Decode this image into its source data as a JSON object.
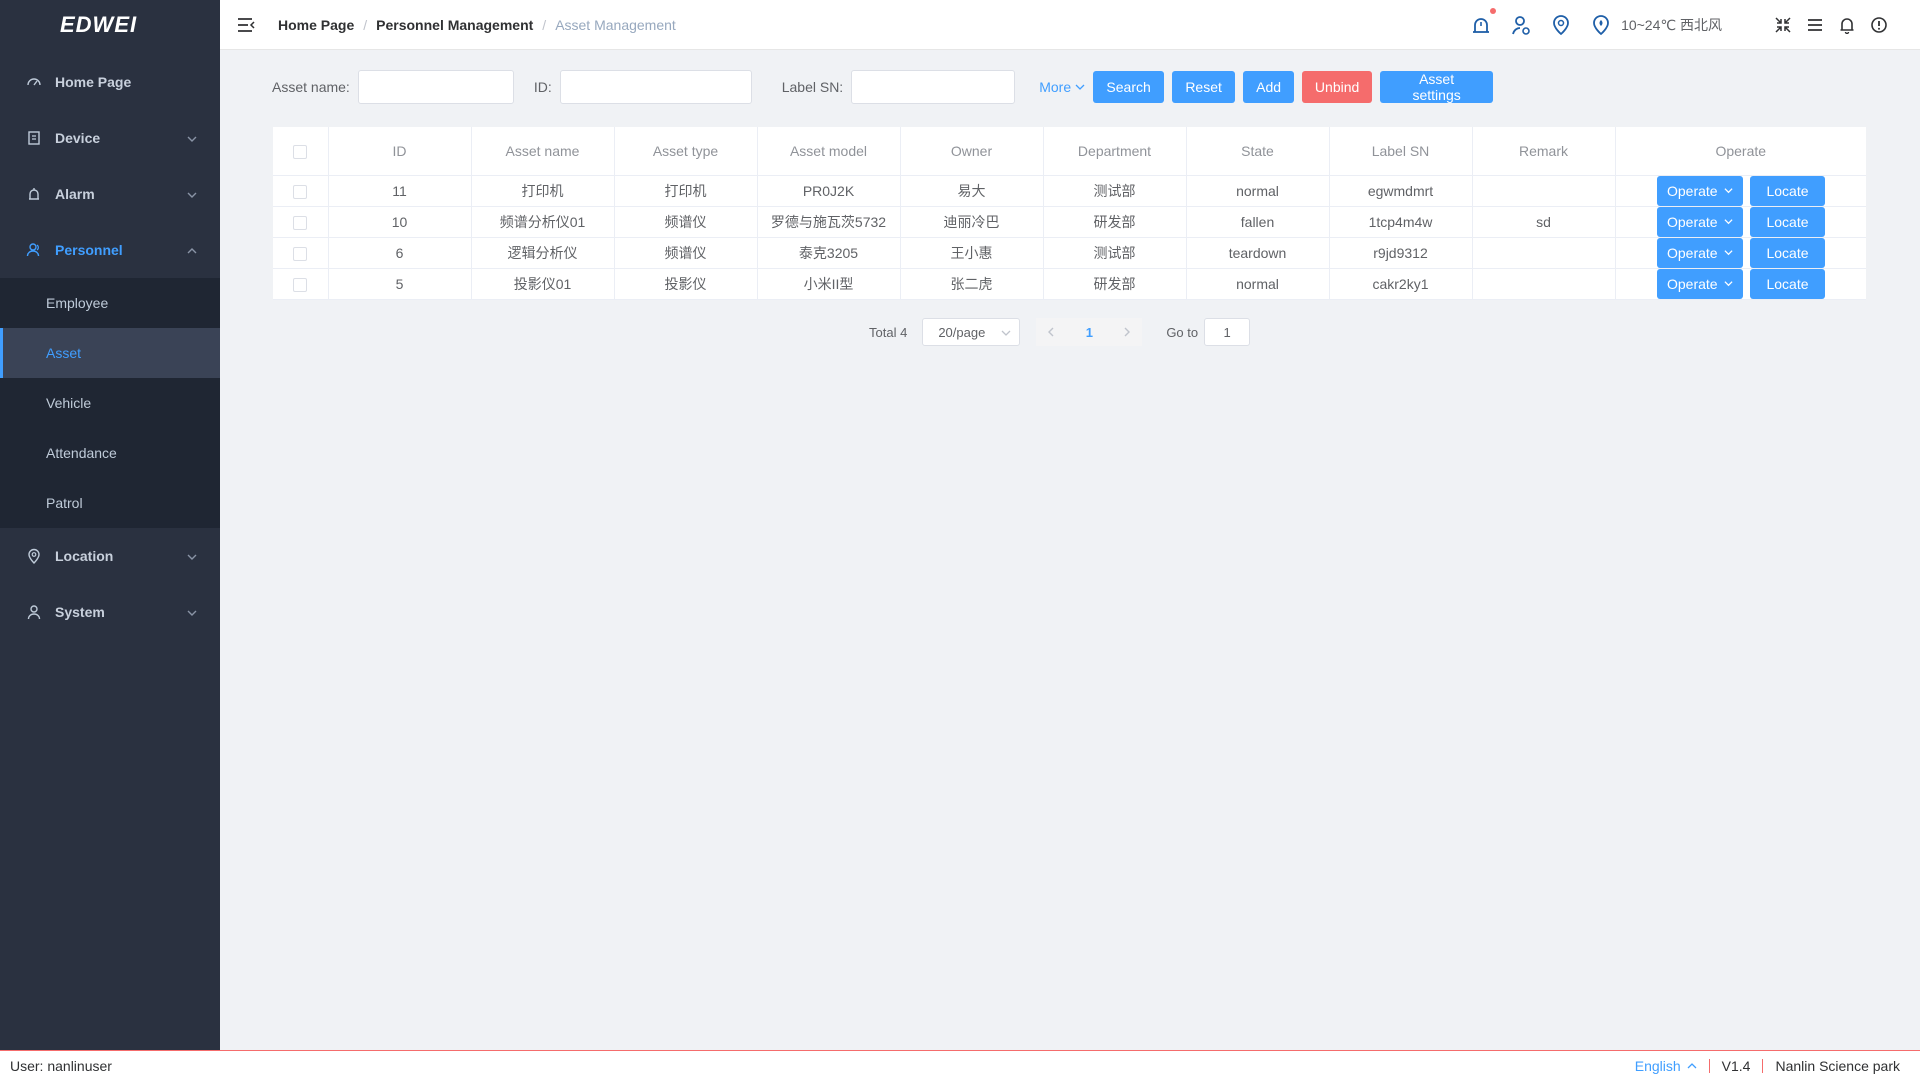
{
  "logo": {
    "text": "EDWEI"
  },
  "sidebar": {
    "items": [
      {
        "label": "Home Page",
        "icon": "dashboard-icon"
      },
      {
        "label": "Device",
        "icon": "device-icon"
      },
      {
        "label": "Alarm",
        "icon": "alarm-icon"
      },
      {
        "label": "Personnel",
        "icon": "personnel-icon"
      },
      {
        "label": "Location",
        "icon": "location-icon"
      },
      {
        "label": "System",
        "icon": "user-icon"
      }
    ],
    "personnel_sub": [
      {
        "label": "Employee"
      },
      {
        "label": "Asset"
      },
      {
        "label": "Vehicle"
      },
      {
        "label": "Attendance"
      },
      {
        "label": "Patrol"
      }
    ]
  },
  "breadcrumb": [
    "Home Page",
    "Personnel Management",
    "Asset Management"
  ],
  "header": {
    "weather": "10~24℃ 西北风"
  },
  "filters": {
    "asset_name_label": "Asset name:",
    "id_label": "ID:",
    "label_sn_label": "Label SN:",
    "asset_name_value": "",
    "id_value": "",
    "label_sn_value": "",
    "more": "More",
    "search": "Search",
    "reset": "Reset",
    "add": "Add",
    "unbind": "Unbind",
    "asset_settings": "Asset settings"
  },
  "table": {
    "columns": [
      "ID",
      "Asset name",
      "Asset type",
      "Asset model",
      "Owner",
      "Department",
      "State",
      "Label SN",
      "Remark",
      "Operate"
    ],
    "rows": [
      {
        "id": "11",
        "name": "打印机",
        "type": "打印机",
        "model": "PR0J2K",
        "owner": "易大",
        "dept": "测试部",
        "state": "normal",
        "sn": "egwmdmrt",
        "remark": ""
      },
      {
        "id": "10",
        "name": "频谱分析仪01",
        "type": "频谱仪",
        "model": "罗德与施瓦茨5732",
        "owner": "迪丽冷巴",
        "dept": "研发部",
        "state": "fallen",
        "sn": "1tcp4m4w",
        "remark": "sd"
      },
      {
        "id": "6",
        "name": "逻辑分析仪",
        "type": "频谱仪",
        "model": "泰克3205",
        "owner": "王小惠",
        "dept": "测试部",
        "state": "teardown",
        "sn": "r9jd9312",
        "remark": ""
      },
      {
        "id": "5",
        "name": "投影仪01",
        "type": "投影仪",
        "model": "小米II型",
        "owner": "张二虎",
        "dept": "研发部",
        "state": "normal",
        "sn": "cakr2ky1",
        "remark": ""
      }
    ],
    "operate_label": "Operate",
    "locate_label": "Locate"
  },
  "pagination": {
    "total": "Total 4",
    "page_size": "20/page",
    "current_page": "1",
    "goto_label": "Go to",
    "goto_value": "1"
  },
  "footer": {
    "user": "User:  nanlinuser",
    "language": "English",
    "version": "V1.4",
    "site": "Nanlin Science park"
  },
  "colors": {
    "primary": "#409eff",
    "danger": "#f56c6c",
    "sidebar": "#2a3140"
  }
}
